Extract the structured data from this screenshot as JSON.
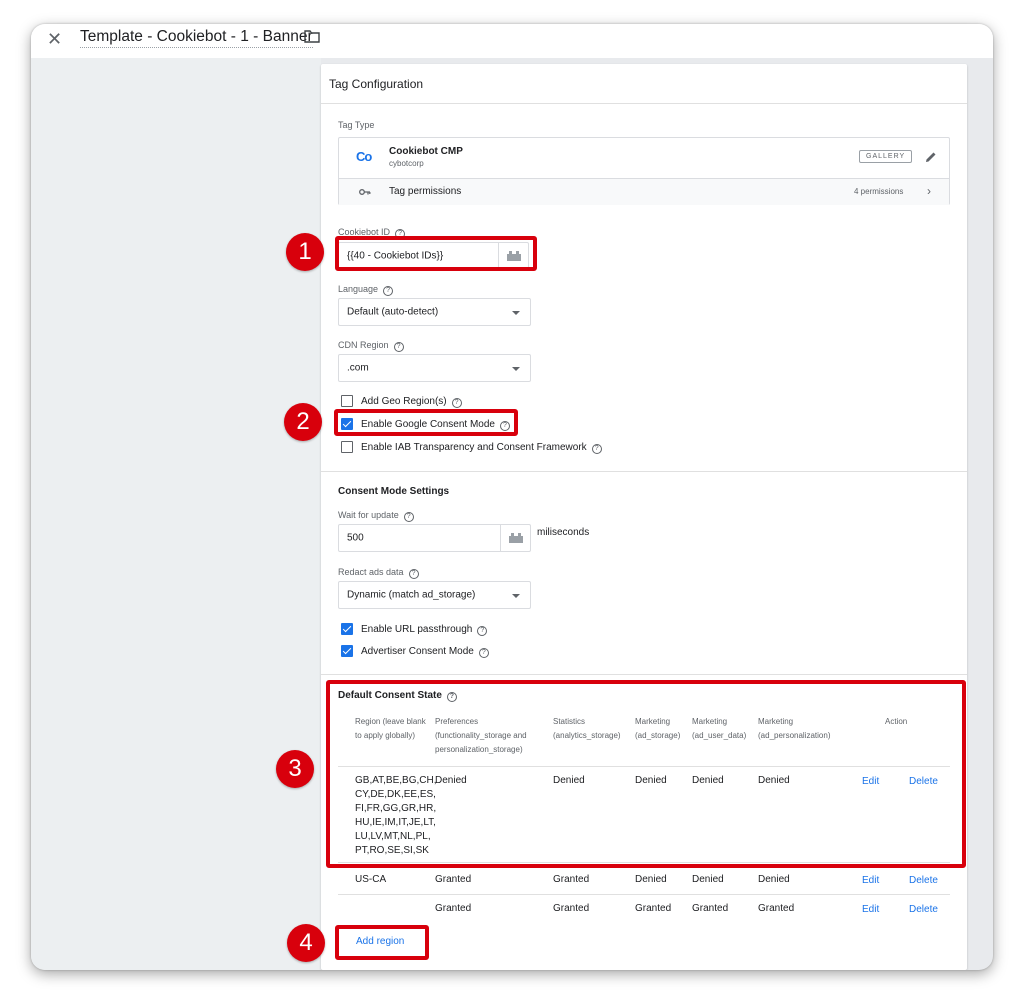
{
  "window": {
    "title": "Template - Cookiebot - 1 - Banner"
  },
  "panel": {
    "header": "Tag Configuration",
    "tag_type_label": "Tag Type",
    "tag_type": {
      "name": "Cookiebot CMP",
      "vendor": "cybotcorp",
      "gallery_badge": "GALLERY",
      "permissions_label": "Tag permissions",
      "permissions_count": "4 permissions"
    },
    "cookiebot_id": {
      "label": "Cookiebot ID",
      "value": "{{40 - Cookiebot IDs}}"
    },
    "language": {
      "label": "Language",
      "value": "Default (auto-detect)"
    },
    "cdn_region": {
      "label": "CDN Region",
      "value": ".com"
    },
    "checkboxes": {
      "geo_region": {
        "label": "Add Geo Region(s)",
        "checked": false
      },
      "google_consent": {
        "label": "Enable Google Consent Mode",
        "checked": true
      },
      "iab": {
        "label": "Enable IAB Transparency and Consent Framework",
        "checked": false
      }
    },
    "consent_mode": {
      "title": "Consent Mode Settings",
      "wait_label": "Wait for update",
      "wait_value": "500",
      "wait_unit": "miliseconds",
      "redact_label": "Redact ads data",
      "redact_value": "Dynamic (match ad_storage)",
      "url_passthrough": {
        "label": "Enable URL passthrough",
        "checked": true
      },
      "advertiser": {
        "label": "Advertiser Consent Mode",
        "checked": true
      }
    },
    "default_consent": {
      "title": "Default Consent State",
      "headers": {
        "region": "Region (leave blank to apply globally)",
        "preferences": "Preferences (functionality_storage and personalization_storage)",
        "statistics": "Statistics (analytics_storage)",
        "marketing_ad": "Marketing (ad_storage)",
        "marketing_user": "Marketing (ad_user_data)",
        "marketing_pers": "Marketing (ad_personalization)",
        "action": "Action"
      },
      "rows": [
        {
          "region": "GB,AT,BE,BG,CH,CY,DE,DK,EE,ES,FI,FR,GG,GR,HR,HU,IE,IM,IT,JE,LT,LU,LV,MT,NL,PL,PT,RO,SE,SI,SK",
          "preferences": "Denied",
          "statistics": "Denied",
          "ad_storage": "Denied",
          "ad_user_data": "Denied",
          "ad_personalization": "Denied",
          "edit": "Edit",
          "delete": "Delete"
        },
        {
          "region": "US-CA",
          "preferences": "Granted",
          "statistics": "Granted",
          "ad_storage": "Denied",
          "ad_user_data": "Denied",
          "ad_personalization": "Denied",
          "edit": "Edit",
          "delete": "Delete"
        },
        {
          "region": "",
          "preferences": "Granted",
          "statistics": "Granted",
          "ad_storage": "Granted",
          "ad_user_data": "Granted",
          "ad_personalization": "Granted",
          "edit": "Edit",
          "delete": "Delete"
        }
      ],
      "add_region": "Add region"
    }
  },
  "annotations": [
    "1",
    "2",
    "3",
    "4"
  ],
  "colors": {
    "accent": "#1a73e8",
    "annotation": "#d8000c"
  }
}
